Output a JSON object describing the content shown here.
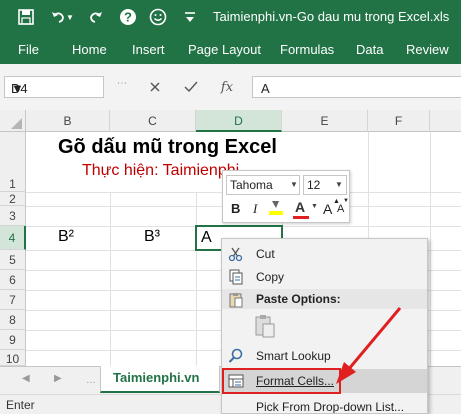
{
  "titlebar": {
    "title": "Taimienphi.vn-Go dau mu trong Excel.xls"
  },
  "ribbon": {
    "tabs": [
      "File",
      "Home",
      "Insert",
      "Page Layout",
      "Formulas",
      "Data",
      "Review"
    ]
  },
  "formula_bar": {
    "name_box": "D4",
    "formula": "A",
    "fx": "fx"
  },
  "columns": [
    "B",
    "C",
    "D",
    "E",
    "F"
  ],
  "rows": [
    "1",
    "2",
    "3",
    "4",
    "5",
    "6",
    "7",
    "8",
    "9",
    "10"
  ],
  "cells": {
    "title": "Gõ dấu mũ trong Excel",
    "subtitle": "Thực hiện: Taimienphi",
    "b4": "B²",
    "c4": "B³",
    "d4": "A"
  },
  "mini_toolbar": {
    "font": "Tahoma",
    "size": "12",
    "bold": "B",
    "italic": "I",
    "font_color": "A",
    "grow": "A",
    "shrink": "A"
  },
  "context_menu": {
    "cut": "Cut",
    "copy": "Copy",
    "paste_options": "Paste Options:",
    "smart_lookup": "Smart Lookup",
    "format_cells": "Format Cells...",
    "pick_list": "Pick From Drop-down List..."
  },
  "sheet_tab": "Taimienphi.vn",
  "status": "Enter",
  "colors": {
    "brand": "#217346",
    "highlight": "#e02020",
    "title_text": "#000000",
    "subtitle_text": "#c00000"
  }
}
